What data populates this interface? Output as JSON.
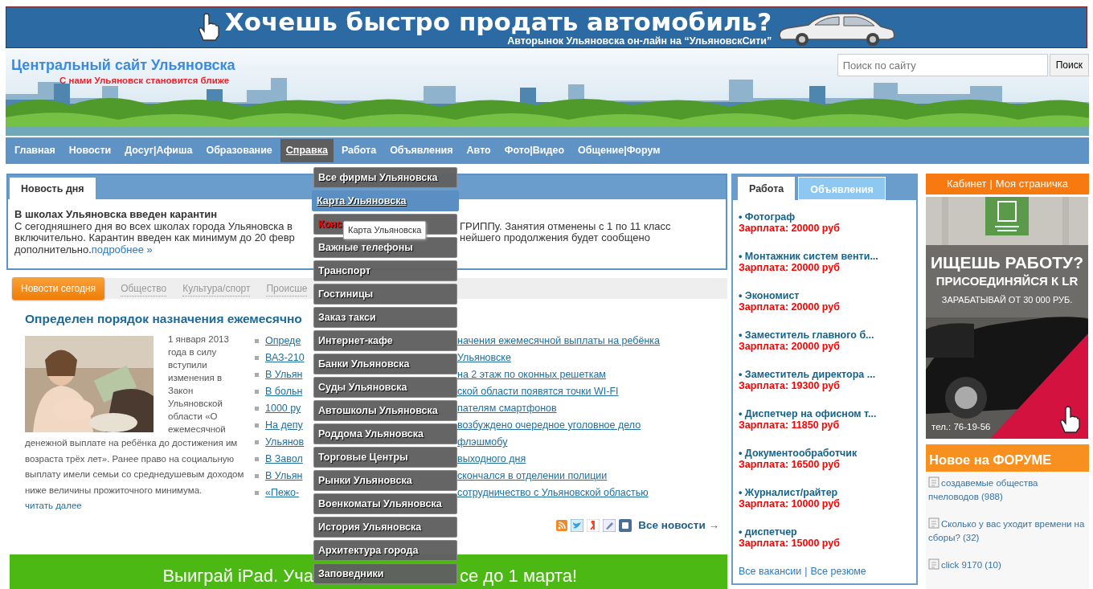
{
  "banner": {
    "headline": "Хочешь быстро продать автомобиль?",
    "subline": "Авторынок Ульяновска он-лайн на “УльяновскСити”"
  },
  "header": {
    "title": "Центральный сайт Ульяновска",
    "tagline": "С нами Ульяновск становится ближе",
    "search": {
      "placeholder": "Поиск по сайту",
      "button": "Поиск"
    }
  },
  "nav": [
    {
      "label": "Главная",
      "selected": false
    },
    {
      "label": "Новости",
      "selected": false
    },
    {
      "label": "Досуг|Афиша",
      "selected": false
    },
    {
      "label": "Образование",
      "selected": false
    },
    {
      "label": "Справка",
      "selected": true
    },
    {
      "label": "Работа",
      "selected": false
    },
    {
      "label": "Объявления",
      "selected": false
    },
    {
      "label": "Авто",
      "selected": false
    },
    {
      "label": "Фото|Видео",
      "selected": false
    },
    {
      "label": "Общение|Форум",
      "selected": false
    }
  ],
  "dropdown": [
    {
      "label": "Все фирмы Ульяновска",
      "selected": false,
      "highlight": false
    },
    {
      "label": "Карта Ульяновска",
      "selected": true,
      "highlight": false
    },
    {
      "label": "Конс",
      "selected": false,
      "highlight": true
    },
    {
      "label": "Важные телефоны",
      "selected": false,
      "highlight": false
    },
    {
      "label": "Транспорт",
      "selected": false,
      "highlight": false
    },
    {
      "label": "Гостиницы",
      "selected": false,
      "highlight": false
    },
    {
      "label": "Заказ такси",
      "selected": false,
      "highlight": false
    },
    {
      "label": "Интернет-кафе",
      "selected": false,
      "highlight": false
    },
    {
      "label": "Банки Ульяновска",
      "selected": false,
      "highlight": false
    },
    {
      "label": "Суды Ульяновска",
      "selected": false,
      "highlight": false
    },
    {
      "label": "Автошколы Ульяновска",
      "selected": false,
      "highlight": false
    },
    {
      "label": "Роддома Ульяновска",
      "selected": false,
      "highlight": false
    },
    {
      "label": "Торговые Центры",
      "selected": false,
      "highlight": false
    },
    {
      "label": "Рынки Ульяновска",
      "selected": false,
      "highlight": false
    },
    {
      "label": "Военкоматы Ульяновска",
      "selected": false,
      "highlight": false
    },
    {
      "label": "История Ульяновска",
      "selected": false,
      "highlight": false
    },
    {
      "label": "Архитектура города",
      "selected": false,
      "highlight": false
    },
    {
      "label": "Заповедники",
      "selected": false,
      "highlight": false
    }
  ],
  "tooltip": "Карта Ульяновска",
  "news_of_day": {
    "tab": "Новость дня",
    "headline": "В школах Ульяновска введен карантин",
    "lines": [
      {
        "left": "С сегодняшнего дня во всех школах города Ульяновска в",
        "right": "ГРИППу. Занятия отменены с 1 по 11 класс"
      },
      {
        "left": "включительно. Карантин введен как минимум до 20 февр",
        "right": "нейшего продолжения будет сообщено"
      }
    ],
    "last": "дополнительно.",
    "more": "подробнее »"
  },
  "news_tabs": [
    {
      "label": "Новости сегодня",
      "selected": true
    },
    {
      "label": "Общество",
      "selected": false
    },
    {
      "label": "Культура/спорт",
      "selected": false
    },
    {
      "label": "Происше",
      "selected": false
    }
  ],
  "article": {
    "headline": "Определен порядок назначения ежемесячно",
    "date": "1 января 2013",
    "text_beside": "года в силу вступили изменения в Закон Ульяновской области «О ежемесячной",
    "text_below": "денежной выплате на ребёнка до достижения им возраста трёх лет». Ранее право на социальную выплату имели семьи со среднедушевым доходом ниже величины прожиточного минимума.",
    "more": "читать далее"
  },
  "news_list": [
    {
      "left": "Опреде",
      "right": "начения ежемесячной выплаты на ребёнка"
    },
    {
      "left": "ВАЗ-210",
      "right": "Ульяновске"
    },
    {
      "left": "В Ульян",
      "right": "на 2 этаж по оконных решеткам"
    },
    {
      "left": "В больн",
      "right": "ской области появятся точки WI-FI"
    },
    {
      "left": "1000 ру",
      "right": "пателям смартфонов"
    },
    {
      "left": "На депу",
      "right": "возбуждено очередное уголовное дело"
    },
    {
      "left": "Ульянов",
      "right": "флэшмобу"
    },
    {
      "left": "В Завол",
      "right": "выходного дня"
    },
    {
      "left": "В Ульян",
      "right": "скончался в отделении полиции"
    },
    {
      "left": "«Пежо-",
      "right": "сотрудничество с Ульяновской областью"
    }
  ],
  "all_news": "Все новости →",
  "promo": {
    "left": "Выиграй iPad. Уча",
    "right": "се до 1 марта!"
  },
  "jobs": {
    "tabs": [
      {
        "label": "Работа",
        "selected": true
      },
      {
        "label": "Объявления",
        "selected": false
      }
    ],
    "items": [
      {
        "title": "• Фотограф",
        "salary": "Зарплата: 20000 руб"
      },
      {
        "title": "• Монтажник систем венти...",
        "salary": "Зарплата: 20000 руб"
      },
      {
        "title": "• Экономист",
        "salary": "Зарплата: 20000 руб"
      },
      {
        "title": "• Заместитель главного б...",
        "salary": "Зарплата: 20000 руб"
      },
      {
        "title": "• Заместитель директора ...",
        "salary": "Зарплата: 19300 руб"
      },
      {
        "title": "• Диспетчер на офисном т...",
        "salary": "Зарплата: 11850 руб"
      },
      {
        "title": "• Документообработчик",
        "salary": "Зарплата: 16500 руб"
      },
      {
        "title": "• Журналист/райтер",
        "salary": "Зарплата: 10000 руб"
      },
      {
        "title": "• диспетчер",
        "salary": "Зарплата: 15000 руб"
      }
    ],
    "links": [
      "Все вакансии",
      "Все резюме"
    ],
    "separator": "|"
  },
  "cabinet": {
    "links": [
      "Кабинет",
      "Моя страничка"
    ],
    "separator": "|"
  },
  "ad": {
    "headline": "ИЩЕШЬ РАБОТУ?",
    "subline": "ПРИСОЕДИНЯЙСЯ К LR",
    "offer": "ЗАРАБАТЫВАЙ ОТ 30 000 РУБ.",
    "phone": "тел.: 76-19-56"
  },
  "forum": {
    "title": "Новое на ФОРУМЕ",
    "topics": [
      "создавемые общества пчеловодов (988)",
      "Сколько у вас уходит времени на сборы? (32)",
      "click 9170 (10)"
    ]
  }
}
